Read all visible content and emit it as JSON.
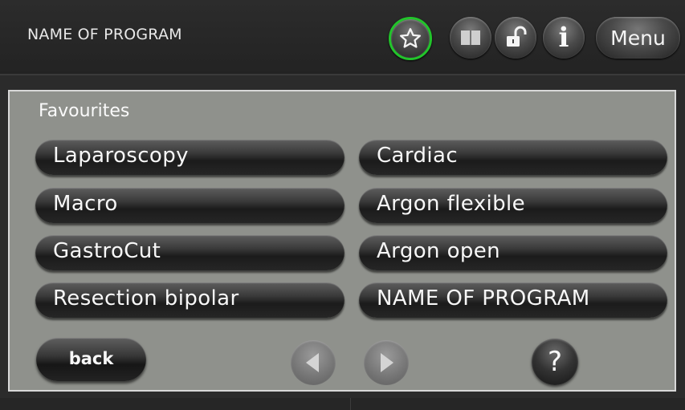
{
  "header": {
    "program_name": "NAME OF PROGRAM",
    "menu_label": "Menu",
    "info_glyph": "i",
    "active_icon_color": "#22c42b"
  },
  "panel": {
    "title": "Favourites",
    "programs_left": [
      "Laparoscopy",
      "Macro",
      "GastroCut",
      "Resection bipolar"
    ],
    "programs_right": [
      "Cardiac",
      "Argon flexible",
      "Argon open",
      "NAME OF PROGRAM"
    ],
    "back_label": "back",
    "help_label": "?"
  },
  "icons": {
    "favourites": "star-icon",
    "manual": "book-icon",
    "lock": "unlock-icon",
    "info": "info-icon",
    "prev": "arrow-left-icon",
    "next": "arrow-right-icon"
  }
}
